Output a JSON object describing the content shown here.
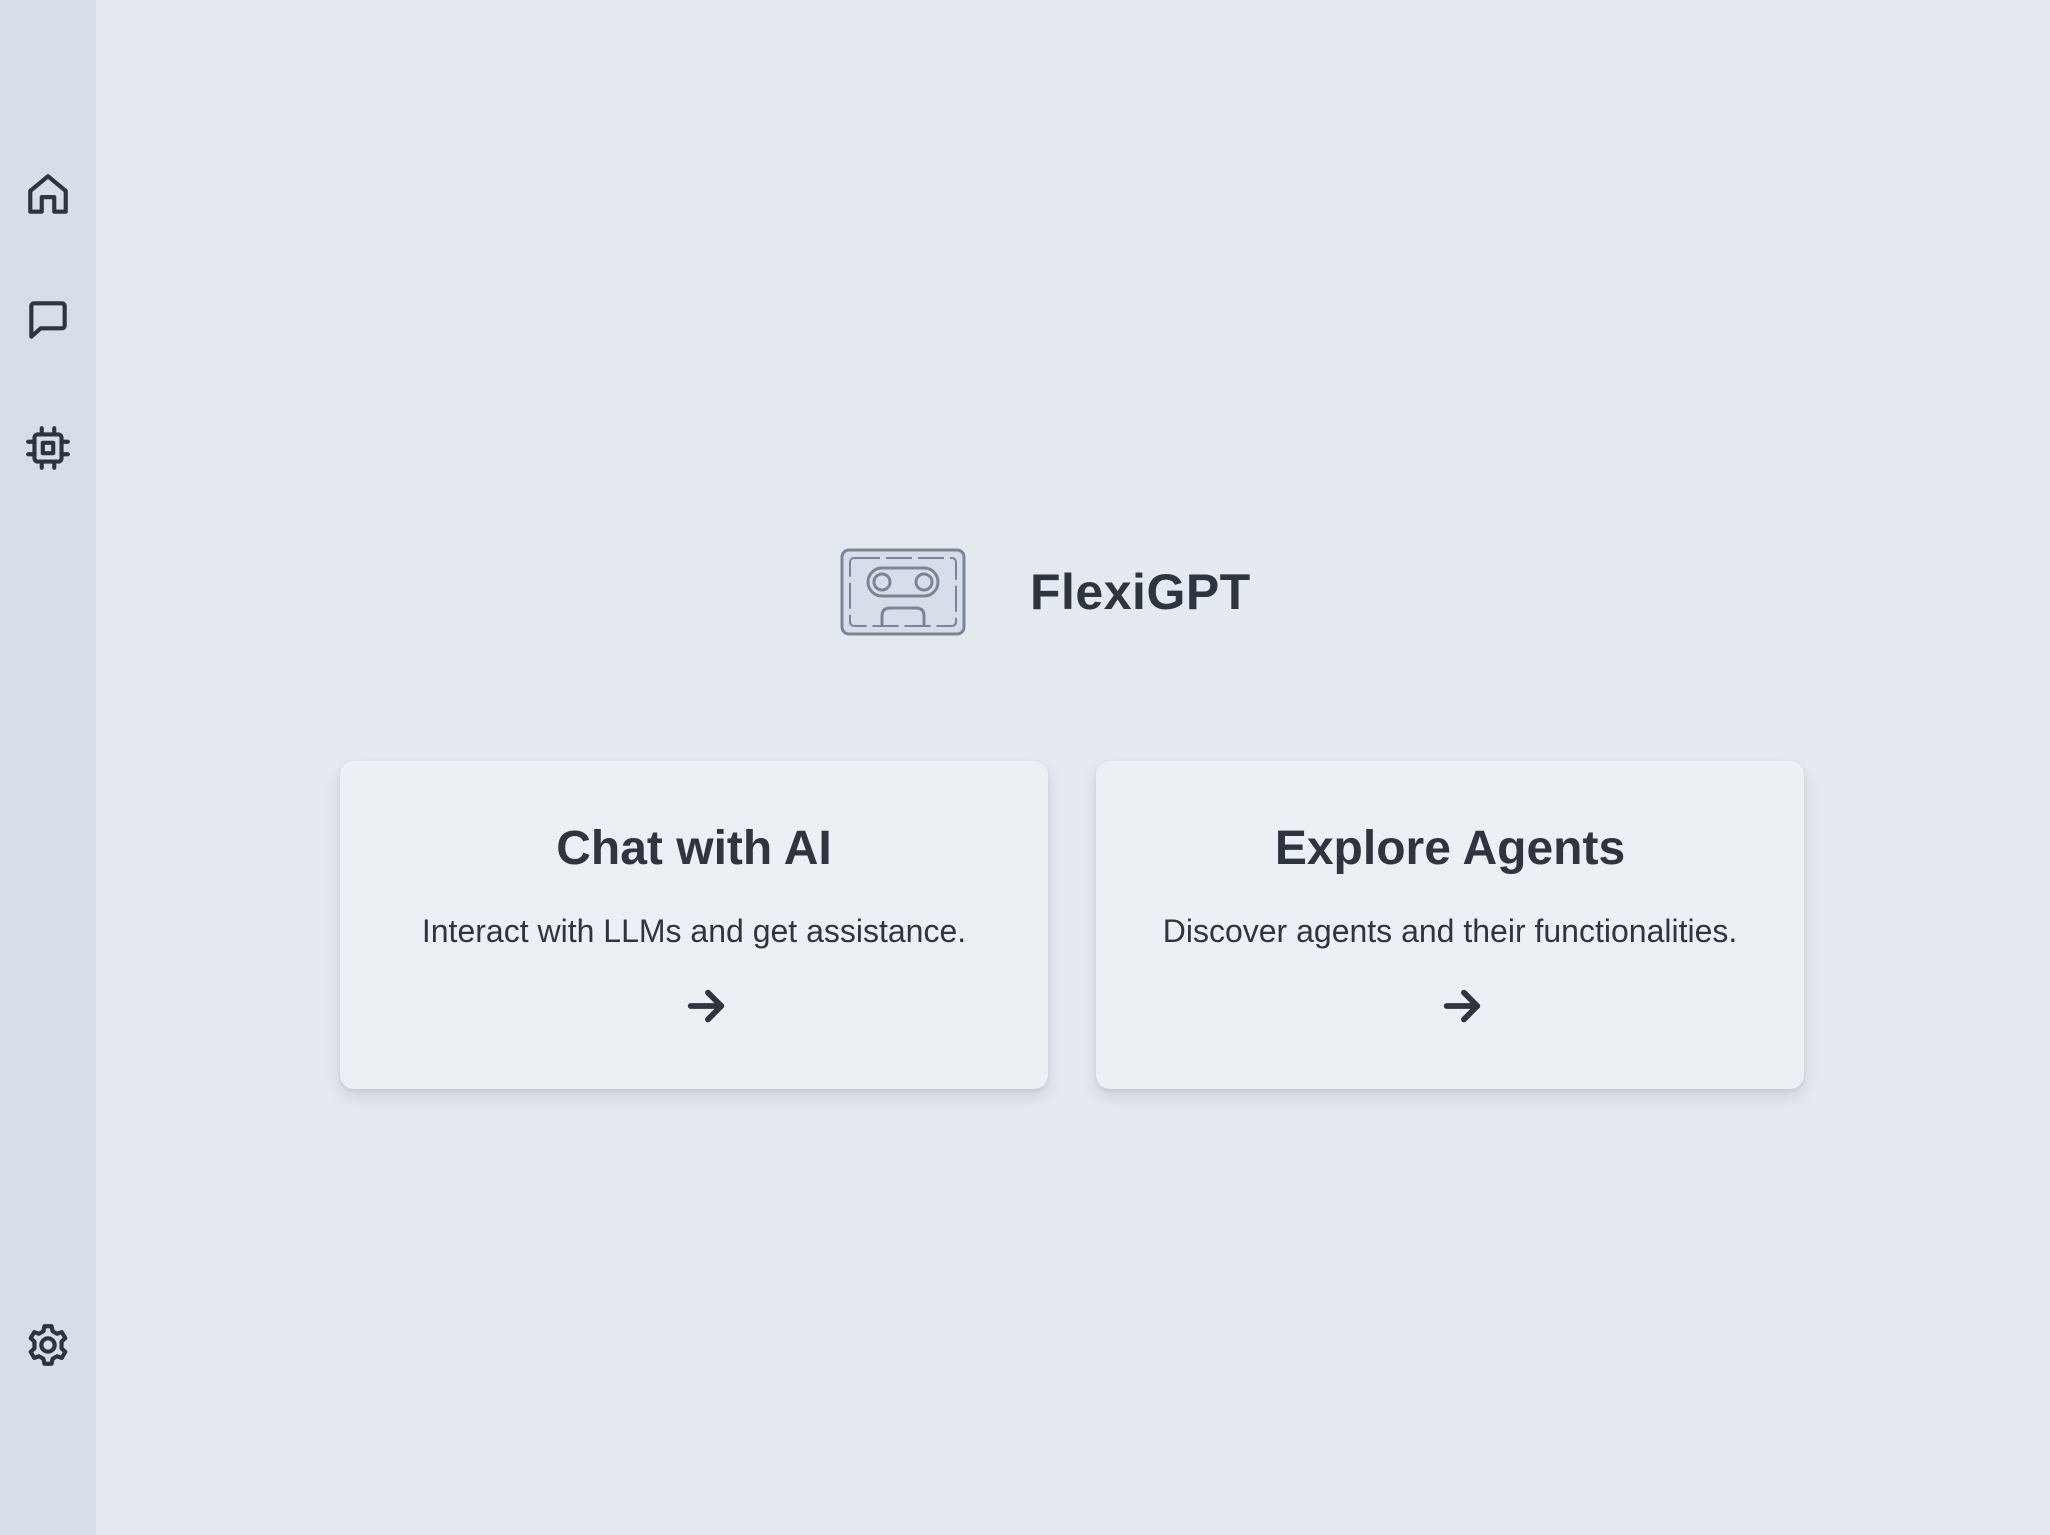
{
  "sidebar": {
    "items": [
      {
        "name": "home",
        "icon": "home-icon"
      },
      {
        "name": "chats",
        "icon": "chat-bubble-icon"
      },
      {
        "name": "agents",
        "icon": "cpu-chip-icon"
      }
    ],
    "settings": {
      "icon": "gear-icon"
    }
  },
  "brand": {
    "logo_icon": "robot-cassette-logo-icon",
    "title": "FlexiGPT"
  },
  "cards": [
    {
      "title": "Chat with AI",
      "description": "Interact with LLMs and get assistance.",
      "icon": "arrow-right-icon"
    },
    {
      "title": "Explore Agents",
      "description": "Discover agents and their functionalities.",
      "icon": "arrow-right-icon"
    }
  ],
  "colors": {
    "background": "#e5e9f0",
    "sidebar": "#d8dee9",
    "card": "#eceff4",
    "text": "#2e3440",
    "logo_fill": "#d8dee9",
    "logo_stroke": "#7b8598"
  }
}
